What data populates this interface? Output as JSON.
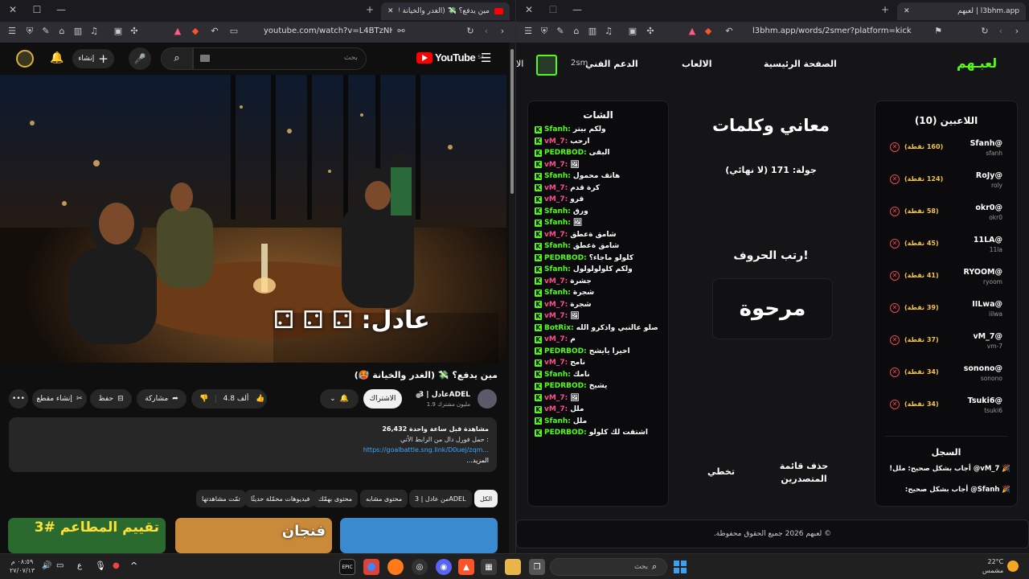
{
  "left_browser": {
    "tab_title": "مين يدفع؟ 💸 (الغدر والخيانة 🥵",
    "url": "youtube.com/watch?v=L4BTzNHpHmc",
    "youtube": {
      "logo_text": "YouTube",
      "logo_region": "SA",
      "search_placeholder": "بحث",
      "create_label": "إنشاء",
      "video_overlay": "عادل: ⚁ ⚁ ⚁",
      "title": "مين يدفع؟ 💸 (الغدر والخيانة 🥵)",
      "channel_name": "عادل | 3ADEL",
      "subscribers": "1.9 مليون مشترك",
      "subscribe_label": "الاشتراك",
      "like_count": "4.8 ألف",
      "share_label": "مشاركة",
      "save_label": "حفظ",
      "clip_label": "إنشاء مقطع",
      "views": "26,432 مشاهدة قبل ساعة واحدة",
      "desc_line": "حمل فورل دال من الرابط الأتي :",
      "desc_link": "https://goalbattle.sng.link/D0uej/zqm...",
      "more_label": "...المزيد",
      "chips": [
        "الكل",
        "من عادل | 3ADEL",
        "محتوى مشابه",
        "محتوى بهمّك",
        "فيديوهات محمّلة حديثًا",
        "تمّت مشاهدتها"
      ],
      "thumb1_text": "تقييم المطاعم #3",
      "thumb2_text": "فنجان"
    }
  },
  "right_browser": {
    "tab_title": "لعبهم | l3bhm.app",
    "url": "l3bhm.app/words/2smer?platform=kick",
    "site": {
      "logo": "لعبـهم",
      "nav": [
        "الصفحة الرئيسية",
        "الالعاب",
        "الدعم الفني"
      ],
      "nav_extra": "الا",
      "user_short": "2sm",
      "players_title": "اللاعبين (10)",
      "players": [
        {
          "handle": "Sfanh@",
          "sub": "sfanh",
          "points": "(160 نقطة)"
        },
        {
          "handle": "RoJy@",
          "sub": "roly",
          "points": "(124 نقطة)"
        },
        {
          "handle": "okr0@",
          "sub": "okr0",
          "points": "(58 نقطة)"
        },
        {
          "handle": "11LA@",
          "sub": "11la",
          "points": "(45 نقطة)"
        },
        {
          "handle": "RYOOM@",
          "sub": "ryoom",
          "points": "(41 نقطة)"
        },
        {
          "handle": "IILwa@",
          "sub": "iilwa",
          "points": "(39 نقطة)"
        },
        {
          "handle": "vM_7@",
          "sub": "vm-7",
          "points": "(37 نقطة)"
        },
        {
          "handle": "sonono@",
          "sub": "sonono",
          "points": "(34 نقطة)"
        },
        {
          "handle": "Tsuki6@",
          "sub": "tsuki6",
          "points": "(34 نقطة)"
        }
      ],
      "log_title": "السجل",
      "log_entries": [
        "🎉 vM_7@ أجاب بشكل صحيح: ملل!",
        "🎉 Sfanh@ أجاب بشكل صحيح:"
      ],
      "game_title": "معاني وكلمات",
      "round": "جولة: 171 (لا نهائي)",
      "instruction": "رتب الحروف!",
      "scrambled": "مرحوة",
      "leaderboard_btn": "حذف قائمة المتصدرين",
      "skip_btn": "تخطي",
      "chat_title": "الشات",
      "chat": [
        {
          "user": "Sfanh:",
          "color": "#53fc18",
          "msg": "ولكم بيتر"
        },
        {
          "user": "vM_7:",
          "color": "#ff4d8a",
          "msg": "ارحب"
        },
        {
          "user": "PEDRBOD:",
          "color": "#53fc18",
          "msg": "البقى"
        },
        {
          "user": "vM_7:",
          "color": "#ff4d8a",
          "msg": "🖼"
        },
        {
          "user": "Sfanh:",
          "color": "#53fc18",
          "msg": "هاتف محمول"
        },
        {
          "user": "vM_7:",
          "color": "#ff4d8a",
          "msg": "كرة قدم"
        },
        {
          "user": "vM_7:",
          "color": "#ff4d8a",
          "msg": "قرو"
        },
        {
          "user": "Sfanh:",
          "color": "#53fc18",
          "msg": "ورق"
        },
        {
          "user": "Sfanh:",
          "color": "#53fc18",
          "msg": "🖼"
        },
        {
          "user": "vM_7:",
          "color": "#ff4d8a",
          "msg": "شامق ةعطق"
        },
        {
          "user": "Sfanh:",
          "color": "#53fc18",
          "msg": "شامق ةعطق"
        },
        {
          "user": "PEDRBOD:",
          "color": "#53fc18",
          "msg": "كلولو ماجاء؟"
        },
        {
          "user": "Sfanh:",
          "color": "#53fc18",
          "msg": "ولكم كلولولولول"
        },
        {
          "user": "vM_7:",
          "color": "#ff4d8a",
          "msg": "جشرة"
        },
        {
          "user": "Sfanh:",
          "color": "#53fc18",
          "msg": "شجرة"
        },
        {
          "user": "vM_7:",
          "color": "#ff4d8a",
          "msg": "شجرة"
        },
        {
          "user": "vM_7:",
          "color": "#ff4d8a",
          "msg": "🖼"
        },
        {
          "user": "BotRix:",
          "color": "#53fc18",
          "msg": "صلو عالنبي واذكرو الله"
        },
        {
          "user": "vM_7:",
          "color": "#ff4d8a",
          "msg": "م"
        },
        {
          "user": "PEDRBOD:",
          "color": "#53fc18",
          "msg": "اخيرا يايشح"
        },
        {
          "user": "vM_7:",
          "color": "#ff4d8a",
          "msg": "نامح"
        },
        {
          "user": "Sfanh:",
          "color": "#53fc18",
          "msg": "نامك"
        },
        {
          "user": "PEDRBOD:",
          "color": "#53fc18",
          "msg": "يشيخ"
        },
        {
          "user": "vM_7:",
          "color": "#ff4d8a",
          "msg": "🖼"
        },
        {
          "user": "vM_7:",
          "color": "#ff4d8a",
          "msg": "ملل"
        },
        {
          "user": "Sfanh:",
          "color": "#53fc18",
          "msg": "ملل"
        },
        {
          "user": "PEDRBOD:",
          "color": "#53fc18",
          "msg": "اشتقت لك كلولو"
        }
      ],
      "footer": "© لعبهم 2026 جميع الحقوق محفوظة."
    }
  },
  "taskbar": {
    "search_placeholder": "بحث",
    "weather_temp": "22°C",
    "weather_desc": "مشمس",
    "time": "٠٨:٥٩ م",
    "date": "٢٧/٠٧/١٣",
    "lang": "ع"
  }
}
